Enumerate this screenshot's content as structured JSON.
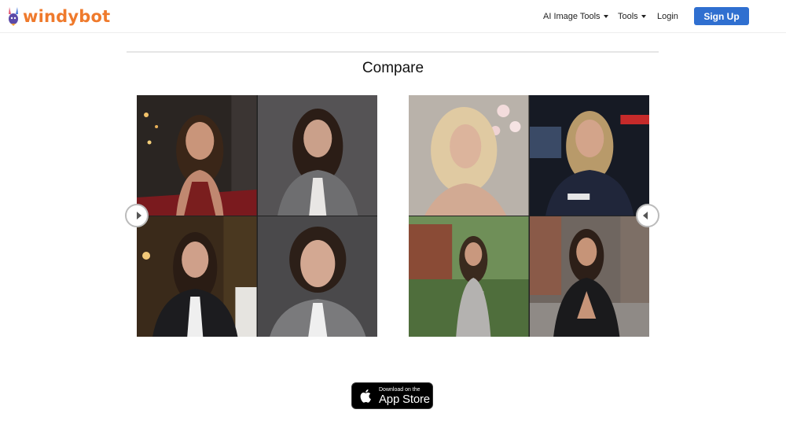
{
  "brand": {
    "name": "windybot",
    "logo_icon": "rabbit-logo-icon",
    "color": "#ef7a2c"
  },
  "nav": {
    "items": [
      {
        "label": "AI Image Tools",
        "has_dropdown": true
      },
      {
        "label": "Tools",
        "has_dropdown": true
      },
      {
        "label": "Login",
        "has_dropdown": false
      }
    ],
    "signup_label": "Sign Up",
    "signup_color": "#2f6fd0"
  },
  "main": {
    "title": "Compare",
    "panels": [
      {
        "name": "compare-panel-left",
        "images": [
          "portrait red dress street",
          "portrait grey suit",
          "portrait black suit restaurant",
          "portrait grey suit closeup"
        ]
      },
      {
        "name": "compare-panel-right",
        "images": [
          "portrait blonde blossoms",
          "portrait police uniform",
          "portrait dress garden",
          "portrait leather jacket street"
        ]
      }
    ]
  },
  "appstore": {
    "small_text": "Download on the",
    "big_text": "App Store",
    "icon": "apple-icon"
  }
}
